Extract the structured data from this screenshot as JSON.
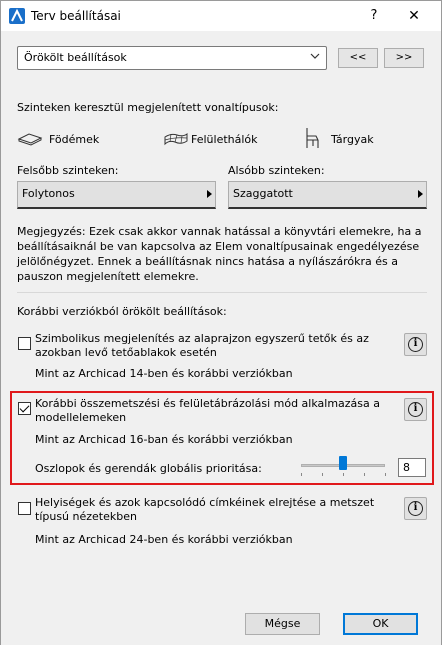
{
  "titlebar": {
    "title": "Terv beállításai",
    "help_glyph": "?",
    "close_glyph": "✕",
    "app_icon": "archicad-icon"
  },
  "preset": {
    "selected": "Örökölt beállítások",
    "prev_label": "<<",
    "next_label": ">>"
  },
  "linetypes": {
    "heading": "Szinteken keresztül megjelenített vonaltípusok:",
    "chips": [
      {
        "label": "Födémek",
        "icon": "slab-icon"
      },
      {
        "label": "Felülethálók",
        "icon": "mesh-icon"
      },
      {
        "label": "Tárgyak",
        "icon": "chair-icon"
      }
    ],
    "upper": {
      "label": "Felsőbb szinteken:",
      "value": "Folytonos"
    },
    "lower": {
      "label": "Alsóbb szinteken:",
      "value": "Szaggatott"
    },
    "note": "Megjegyzés: Ezek csak akkor vannak hatással a könyvtári elemekre, ha a beállításaiknál be van kapcsolva az Elem vonaltípusainak engedélyezése jelölőnégyzet. Ennek a beállításnak nincs hatása a nyílászárókra és a pauszon megjelenített elemekre."
  },
  "legacy": {
    "heading": "Korábbi verziókból örökölt beállítások:",
    "options": [
      {
        "label": "Szimbolikus megjelenítés az alaprajzon egyszerű tetők és az azokban levő tetőablakok esetén",
        "checked": false,
        "sub": "Mint az Archicad 14-ben és korábbi verziókban"
      },
      {
        "label": "Korábbi összemetszési és felületábrázolási mód alkalmazása a modellelemeken",
        "checked": true,
        "sub": "Mint az Archicad 16-ban és korábbi verziókban",
        "priority_label": "Oszlopok és gerendák globális prioritása:",
        "priority_value": "8",
        "priority_fraction": 0.5
      },
      {
        "label": "Helyiségek és azok kapcsolódó címkéinek elrejtése a metszet típusú nézetekben",
        "checked": false,
        "sub": "Mint az Archicad 24-ben és korábbi verziókban"
      }
    ],
    "info_glyph": "i"
  },
  "footer": {
    "cancel_label": "Mégse",
    "ok_label": "OK"
  },
  "colors": {
    "highlight": "#e0181b",
    "accent": "#0078d7"
  }
}
